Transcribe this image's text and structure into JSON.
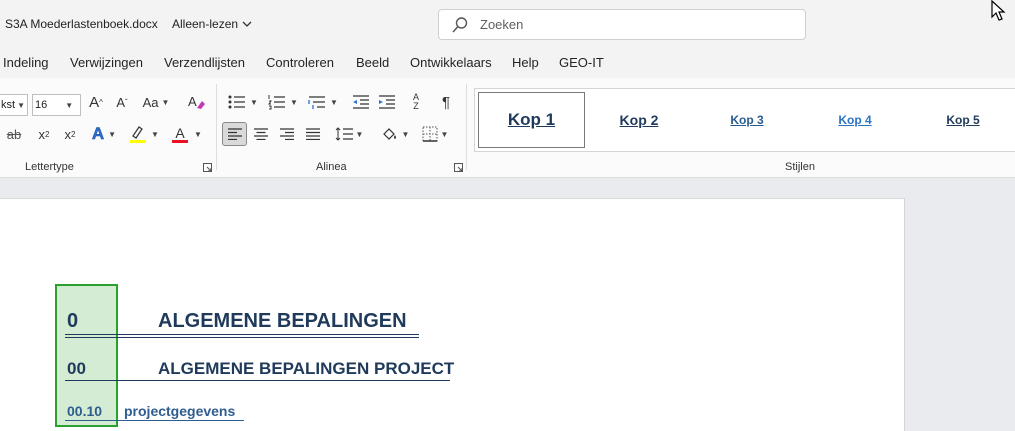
{
  "titlebar": {
    "doc_title": "S3A Moederlastenboek.docx",
    "readonly_label": "Alleen-lezen",
    "search_placeholder": "Zoeken"
  },
  "tabs": [
    "Indeling",
    "Verwijzingen",
    "Verzendlijsten",
    "Controleren",
    "Beeld",
    "Ontwikkelaars",
    "Help",
    "GEO-IT"
  ],
  "ribbon": {
    "font_name_partial": "kst",
    "font_size": "16",
    "grow_label": "A",
    "shrink_label": "A",
    "case_label": "Aa",
    "sub_label": "x",
    "sup_label": "x",
    "sub_digit": "2",
    "sup_digit": "2",
    "strike_label": "ab",
    "effects_label": "A",
    "font_color_label": "A",
    "pilcrow": "¶",
    "sort_label_top": "A",
    "sort_label_bottom": "Z",
    "groups": {
      "font": "Lettertype",
      "paragraph": "Alinea",
      "styles": "Stijlen"
    },
    "styles": [
      "Kop 1",
      "Kop 2",
      "Kop 3",
      "Kop 4",
      "Kop 5"
    ],
    "colors": {
      "highlight": "#ffff00",
      "font_color": "#e81123",
      "accent": "#2b579a"
    }
  },
  "document": {
    "h1_number": "0",
    "h1_text": "ALGEMENE BEPALINGEN",
    "h2_number": "00",
    "h2_text": "ALGEMENE BEPALINGEN PROJECT",
    "h3_number": "00.10",
    "h3_text": "projectgegevens"
  }
}
